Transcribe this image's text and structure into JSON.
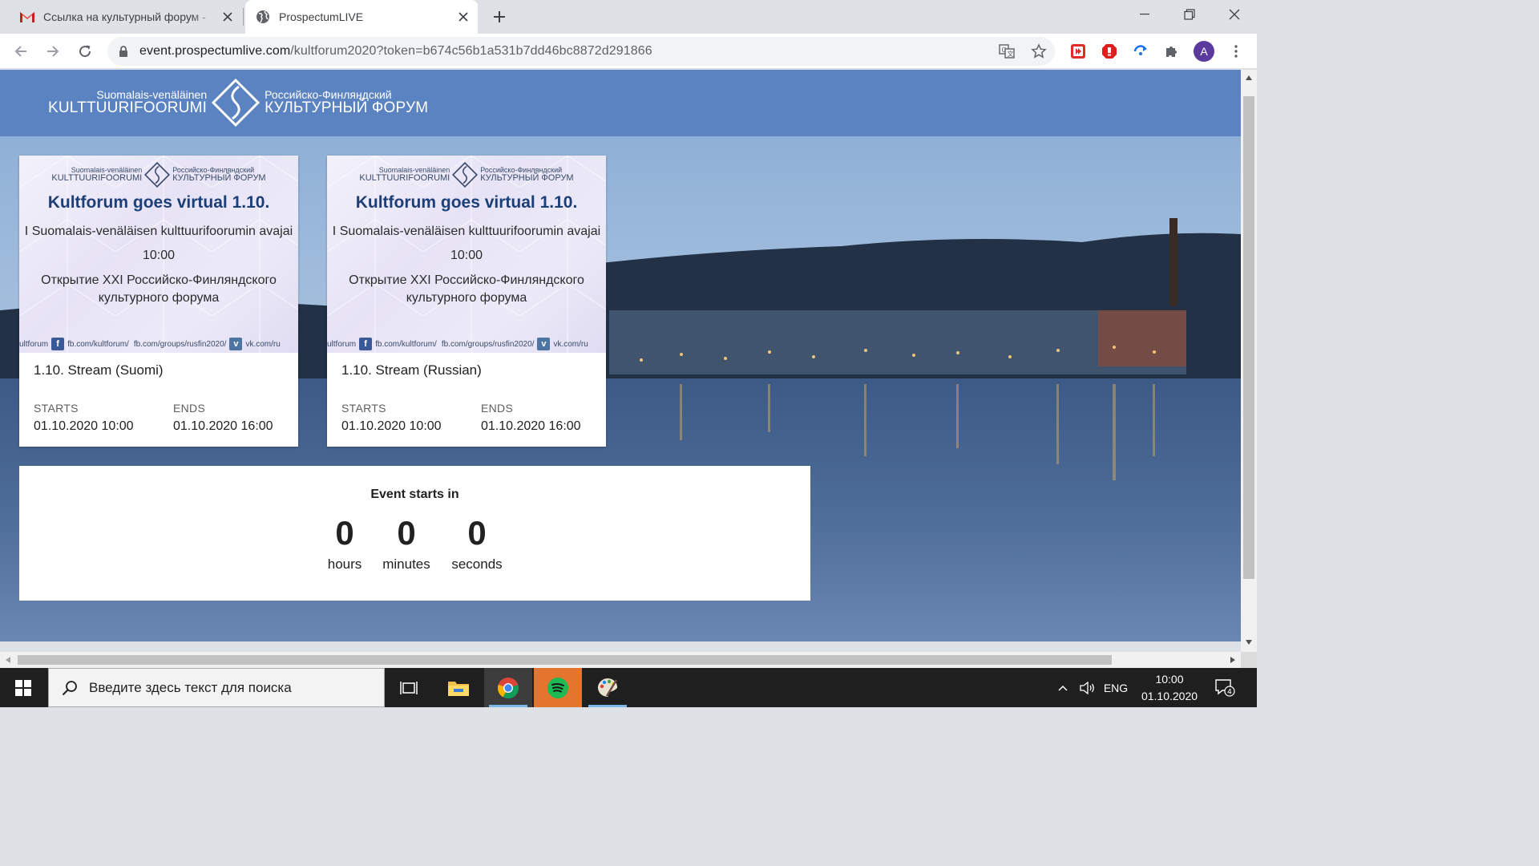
{
  "browser": {
    "tabs": [
      {
        "title": "Ссылка на культурный форум - ",
        "favicon": "gmail-icon",
        "active": false
      },
      {
        "title": "ProspectumLIVE",
        "favicon": "globe-icon",
        "active": true
      }
    ],
    "url": {
      "domain": "event.prospectumlive.com",
      "path": "/kultforum2020?token=b674c56b1a531b7dd46bc8872d291866"
    },
    "profile_initial": "A"
  },
  "site": {
    "logo": {
      "fi_small": "Suomalais-venäläinen",
      "fi_big": "KULTTUURIFOORUMI",
      "ru_small": "Российско-Финляндский",
      "ru_big": "КУЛЬТУРНЫЙ ФОРУМ"
    },
    "header_color": "#5b82c1"
  },
  "cards": [
    {
      "banner": {
        "title": "Kultforum goes virtual 1.10.",
        "line1": "I Suomalais-venäläisen kulttuurifoorumin avajai",
        "time": "10:00",
        "line2": "Открытие XXI Российско-Финляндского культурного форума",
        "social_left": "ultforum",
        "social_fb": "fb.com/kultforum/",
        "social_groups": "fb.com/groups/rusfin2020/",
        "social_vk": "vk.com/ru"
      },
      "title": "1.10. Stream (Suomi)",
      "starts_label": "STARTS",
      "starts": "01.10.2020 10:00",
      "ends_label": "ENDS",
      "ends": "01.10.2020 16:00"
    },
    {
      "banner": {
        "title": "Kultforum goes virtual 1.10.",
        "line1": "I Suomalais-venäläisen kulttuurifoorumin avajai",
        "time": "10:00",
        "line2": "Открытие XXI Российско-Финляндского культурного форума",
        "social_left": "ultforum",
        "social_fb": "fb.com/kultforum/",
        "social_groups": "fb.com/groups/rusfin2020/",
        "social_vk": "vk.com/ru"
      },
      "title": "1.10. Stream (Russian)",
      "starts_label": "STARTS",
      "starts": "01.10.2020 10:00",
      "ends_label": "ENDS",
      "ends": "01.10.2020 16:00"
    }
  ],
  "countdown": {
    "title": "Event starts in",
    "hours": "0",
    "hours_label": "hours",
    "minutes": "0",
    "minutes_label": "minutes",
    "seconds": "0",
    "seconds_label": "seconds"
  },
  "taskbar": {
    "search_placeholder": "Введите здесь текст для поиска",
    "lang": "ENG",
    "time": "10:00",
    "date": "01.10.2020",
    "notifications": "4"
  }
}
